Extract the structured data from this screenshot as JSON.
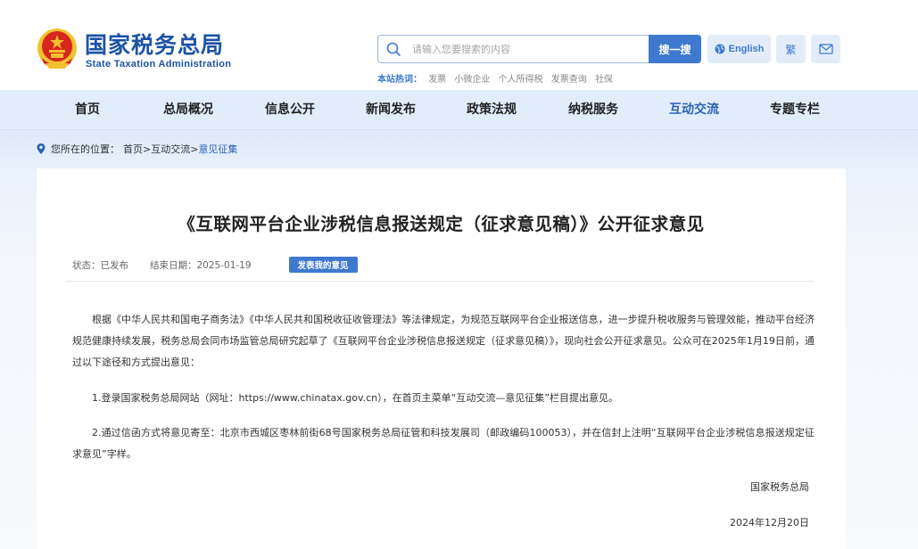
{
  "header": {
    "logo_cn": "国家税务总局",
    "logo_en": "State Taxation Administration",
    "search_placeholder": "请输入您要搜索的内容",
    "search_button": "搜一搜",
    "lang_button": "English",
    "traditional_button": "繁",
    "hot_label": "本站热词：",
    "hot_words": [
      "发票",
      "小微企业",
      "个人所得税",
      "发票查询",
      "社保"
    ]
  },
  "nav": {
    "items": [
      "首页",
      "总局概况",
      "信息公开",
      "新闻发布",
      "政策法规",
      "纳税服务",
      "互动交流",
      "专题专栏"
    ],
    "active_index": 6
  },
  "breadcrumb": {
    "prefix": "您所在的位置：",
    "home": "首页",
    "sep": ">",
    "section": "互动交流",
    "current": "意见征集"
  },
  "article": {
    "title": "《互联网平台企业涉税信息报送规定（征求意见稿）》公开征求意见",
    "status": "状态：已发布",
    "end_date": "结束日期：2025-01-19",
    "comment_button": "发表我的意见",
    "paragraph1": "根据《中华人民共和国电子商务法》《中华人民共和国税收征收管理法》等法律规定，为规范互联网平台企业报送信息，进一步提升税收服务与管理效能，推动平台经济规范健康持续发展，税务总局会同市场监管总局研究起草了《互联网平台企业涉税信息报送规定（征求意见稿）》，现向社会公开征求意见。公众可在2025年1月19日前，通过以下途径和方式提出意见：",
    "paragraph2": "1.登录国家税务总局网站（网址：https://www.chinatax.gov.cn），在首页主菜单“互动交流—意见征集”栏目提出意见。",
    "paragraph3": "2.通过信函方式将意见寄至：北京市西城区枣林前街68号国家税务总局征管和科技发展司（邮政编码100053），并在信封上注明“互联网平台企业涉税信息报送规定征求意见”字样。",
    "signature": "国家税务总局",
    "date": "2024年12月20日"
  },
  "colors": {
    "brand_blue": "#1c53a6",
    "accent_blue": "#3f79cf",
    "nav_bg": "#e2edfb",
    "emblem_red": "#d7261e",
    "emblem_gold": "#f3c12f"
  }
}
